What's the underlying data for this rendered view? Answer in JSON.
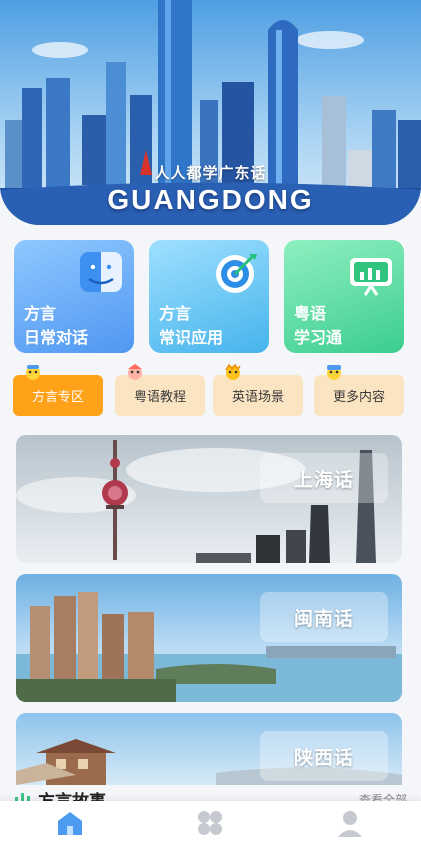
{
  "banner": {
    "slogan": "人人都学广东话",
    "title": "GUANGDONG"
  },
  "feature_cards": [
    {
      "line1": "方言",
      "line2": "日常对话",
      "icon": "finder-face-icon"
    },
    {
      "line1": "方言",
      "line2": "常识应用",
      "icon": "target-icon"
    },
    {
      "line1": "粤语",
      "line2": "学习通",
      "icon": "presentation-board-icon"
    }
  ],
  "category_tabs": [
    {
      "label": "方言专区",
      "active": true
    },
    {
      "label": "粤语教程",
      "active": false
    },
    {
      "label": "英语场景",
      "active": false
    },
    {
      "label": "更多内容",
      "active": false
    }
  ],
  "dialect_cards": [
    {
      "label": "上海话"
    },
    {
      "label": "闽南话"
    },
    {
      "label": "陕西话"
    }
  ],
  "section": {
    "title": "方言故事",
    "more": "查看全部"
  },
  "bottom_nav": [
    {
      "icon": "home-icon",
      "active": true
    },
    {
      "icon": "apps-grid-icon",
      "active": false
    },
    {
      "icon": "user-icon",
      "active": false
    }
  ],
  "colors": {
    "accent": "#ffa21a",
    "tab_bg": "#fbe4c2",
    "nav_active": "#4d9bf0",
    "nav_inactive": "#c6c9cf"
  }
}
